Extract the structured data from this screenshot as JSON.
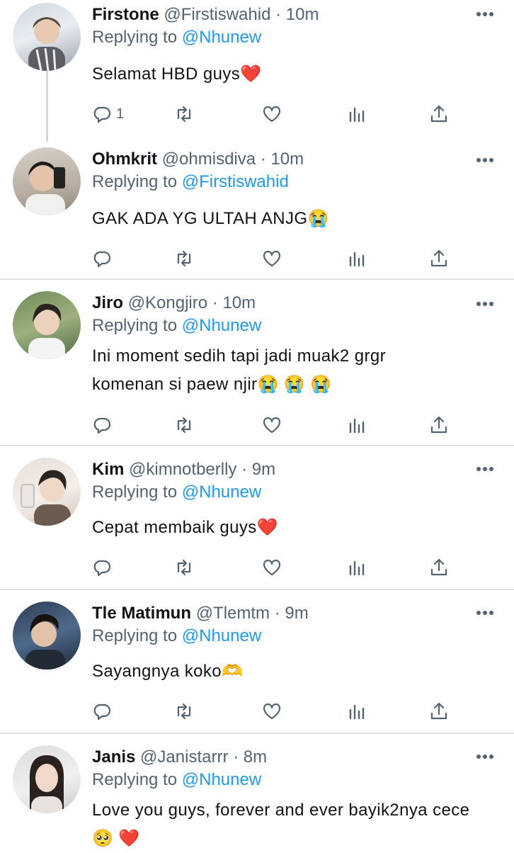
{
  "reply_prefix": "Replying to",
  "tweets": [
    {
      "name": "Firstone",
      "handle": "@Firstiswahid",
      "dot": "·",
      "time": "10m",
      "reply_to": "@Nhunew",
      "text": "Selamat HBD guys",
      "emoji": "❤️",
      "reply_count": "1"
    },
    {
      "name": "Ohmkrit",
      "handle": "@ohmisdiva",
      "dot": "·",
      "time": "10m",
      "reply_to": "@Firstiswahid",
      "text": "GAK ADA YG ULTAH ANJG",
      "emoji": "😭",
      "reply_count": ""
    },
    {
      "name": "Jiro",
      "handle": "@Kongjiro",
      "dot": "·",
      "time": "10m",
      "reply_to": "@Nhunew",
      "text": "Ini moment sedih tapi jadi muak2 grgr komenan si paew njir",
      "emoji": "😭 😭 😭",
      "reply_count": ""
    },
    {
      "name": "Kim",
      "handle": "@kimnotberlly",
      "dot": "·",
      "time": "9m",
      "reply_to": "@Nhunew",
      "text": "Cepat membaik guys",
      "emoji": "❤️",
      "reply_count": ""
    },
    {
      "name": "Tle Matimun",
      "handle": "@Tlemtm",
      "dot": "·",
      "time": "9m",
      "reply_to": "@Nhunew",
      "text": "Sayangnya koko",
      "emoji": "🫶",
      "reply_count": ""
    },
    {
      "name": "Janis",
      "handle": "@Janistarrr",
      "dot": "·",
      "time": "8m",
      "reply_to": "@Nhunew",
      "text": "Love you guys, forever and ever bayik2nya cece",
      "emoji": "🥺 ❤️",
      "reply_count": ""
    }
  ],
  "colors": {
    "link": "#1d9bf0",
    "muted": "#536471",
    "text": "#0f1419",
    "separator": "#dfe3e6"
  },
  "icons": [
    "reply-icon",
    "retweet-icon",
    "like-icon",
    "analytics-icon",
    "share-icon",
    "more-icon"
  ]
}
